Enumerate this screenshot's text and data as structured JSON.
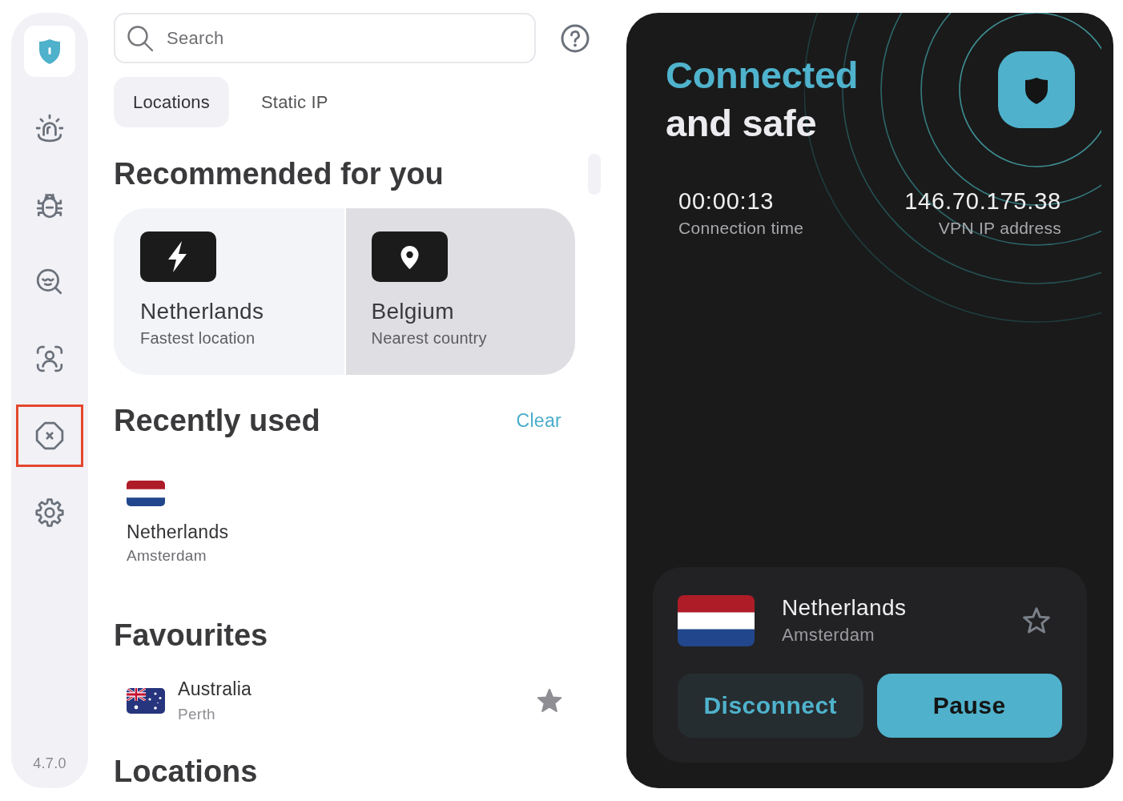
{
  "sidebar": {
    "items": [
      {
        "kind": "siren",
        "highlighted": false
      },
      {
        "kind": "bug",
        "highlighted": false
      },
      {
        "kind": "scan",
        "highlighted": false
      },
      {
        "kind": "identity",
        "highlighted": false
      },
      {
        "kind": "block",
        "highlighted": true
      },
      {
        "kind": "settings",
        "highlighted": false
      }
    ],
    "version": "4.7.0"
  },
  "search": {
    "placeholder": "Search"
  },
  "tabs": [
    {
      "label": "Locations",
      "selected": true
    },
    {
      "label": "Static IP",
      "selected": false
    }
  ],
  "recommended": {
    "title": "Recommended for you",
    "cards": [
      {
        "kind": "fastest",
        "name": "Netherlands",
        "subtitle": "Fastest location",
        "hovered": false
      },
      {
        "kind": "nearest",
        "name": "Belgium",
        "subtitle": "Nearest country",
        "hovered": true
      }
    ]
  },
  "recently_used": {
    "title": "Recently used",
    "action": "Clear",
    "items": [
      {
        "kind": "nl",
        "name": "Netherlands",
        "city": "Amsterdam"
      }
    ]
  },
  "favourites": {
    "title": "Favourites",
    "items": [
      {
        "kind": "au",
        "name": "Australia",
        "city": "Perth",
        "favourite": true
      }
    ]
  },
  "locations": {
    "title": "Locations"
  },
  "status": {
    "headline_accent": "Connected",
    "headline_rest": "and safe",
    "connection_time": "00:00:13",
    "connection_time_label": "Connection time",
    "ip_address": "146.70.175.38",
    "ip_address_label": "VPN IP address"
  },
  "current": {
    "kind": "nl",
    "name": "Netherlands",
    "city": "Amsterdam",
    "favourite": false
  },
  "buttons": [
    {
      "kind": "disconnect",
      "label": "Disconnect"
    },
    {
      "kind": "pause",
      "label": "Pause"
    }
  ]
}
